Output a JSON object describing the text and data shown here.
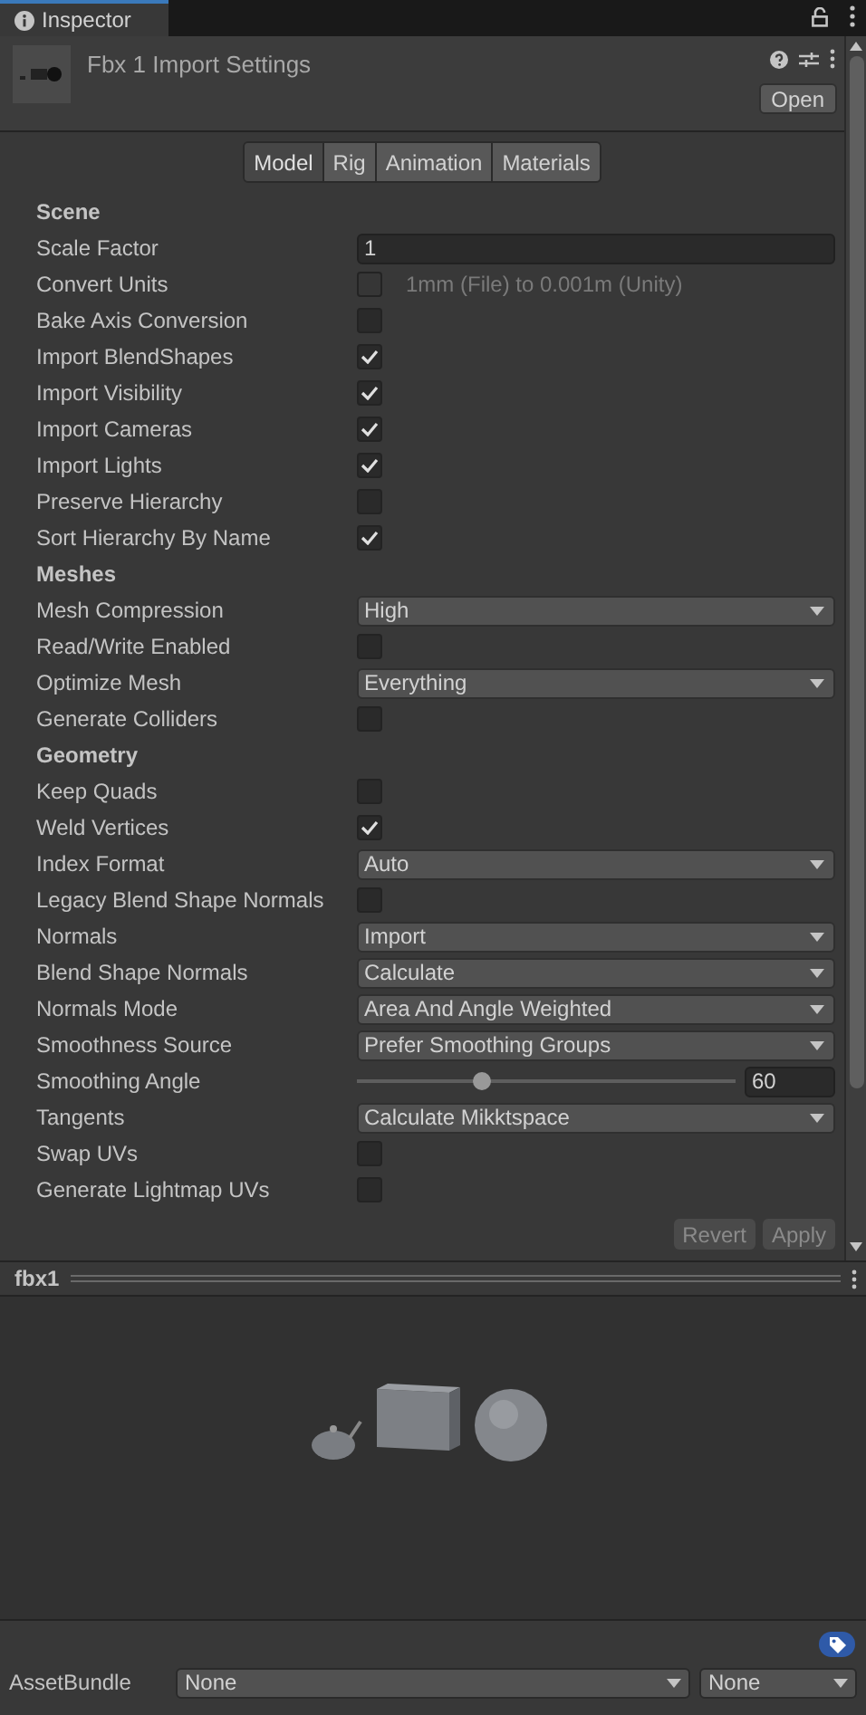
{
  "window": {
    "tab": "Inspector"
  },
  "header": {
    "title": "Fbx 1 Import Settings",
    "open_button": "Open"
  },
  "tabs": [
    {
      "label": "Model",
      "selected": true
    },
    {
      "label": "Rig",
      "selected": false
    },
    {
      "label": "Animation",
      "selected": false
    },
    {
      "label": "Materials",
      "selected": false
    }
  ],
  "rows": [
    {
      "kind": "header",
      "label": "Scene"
    },
    {
      "kind": "text",
      "label": "Scale Factor",
      "value": "1"
    },
    {
      "kind": "checkbox",
      "label": "Convert Units",
      "checked": false,
      "disabled": true,
      "hint": "1mm (File) to 0.001m (Unity)"
    },
    {
      "kind": "checkbox",
      "label": "Bake Axis Conversion",
      "checked": false
    },
    {
      "kind": "checkbox",
      "label": "Import BlendShapes",
      "checked": true
    },
    {
      "kind": "checkbox",
      "label": "Import Visibility",
      "checked": true
    },
    {
      "kind": "checkbox",
      "label": "Import Cameras",
      "checked": true
    },
    {
      "kind": "checkbox",
      "label": "Import Lights",
      "checked": true
    },
    {
      "kind": "checkbox",
      "label": "Preserve Hierarchy",
      "checked": false
    },
    {
      "kind": "checkbox",
      "label": "Sort Hierarchy By Name",
      "checked": true
    },
    {
      "kind": "header",
      "label": "Meshes"
    },
    {
      "kind": "dropdown",
      "label": "Mesh Compression",
      "value": "High"
    },
    {
      "kind": "checkbox",
      "label": "Read/Write Enabled",
      "checked": false
    },
    {
      "kind": "dropdown",
      "label": "Optimize Mesh",
      "value": "Everything"
    },
    {
      "kind": "checkbox",
      "label": "Generate Colliders",
      "checked": false
    },
    {
      "kind": "header",
      "label": "Geometry"
    },
    {
      "kind": "checkbox",
      "label": "Keep Quads",
      "checked": false
    },
    {
      "kind": "checkbox",
      "label": "Weld Vertices",
      "checked": true
    },
    {
      "kind": "dropdown",
      "label": "Index Format",
      "value": "Auto"
    },
    {
      "kind": "checkbox",
      "label": "Legacy Blend Shape Normals",
      "checked": false
    },
    {
      "kind": "dropdown",
      "label": "Normals",
      "value": "Import"
    },
    {
      "kind": "dropdown",
      "label": "Blend Shape Normals",
      "value": "Calculate"
    },
    {
      "kind": "dropdown",
      "label": "Normals Mode",
      "value": "Area And Angle Weighted"
    },
    {
      "kind": "dropdown",
      "label": "Smoothness Source",
      "value": "Prefer Smoothing Groups"
    },
    {
      "kind": "slider",
      "label": "Smoothing Angle",
      "level": 0.33,
      "value": "60"
    },
    {
      "kind": "dropdown",
      "label": "Tangents",
      "value": "Calculate Mikktspace"
    },
    {
      "kind": "checkbox",
      "label": "Swap UVs",
      "checked": false
    },
    {
      "kind": "checkbox",
      "label": "Generate Lightmap UVs",
      "checked": false
    }
  ],
  "buttons": [
    {
      "label": "Revert",
      "disabled": true
    },
    {
      "label": "Apply",
      "disabled": true
    }
  ],
  "preview": {
    "title": "fbx1"
  },
  "asset_bundle": {
    "label": "AssetBundle",
    "name": "None",
    "variant": "None"
  }
}
